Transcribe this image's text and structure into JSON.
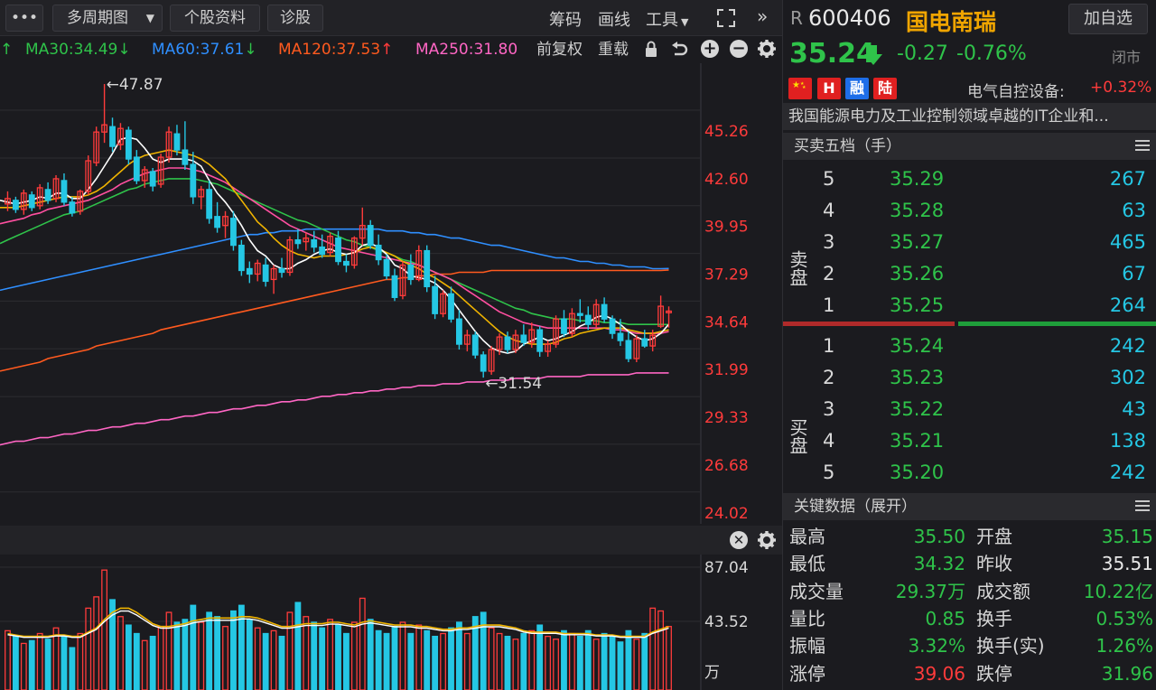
{
  "toolbar": {
    "more_label": "•••",
    "period_label": "多周期图",
    "stock_info_label": "个股资料",
    "diagnose_label": "诊股",
    "chips_label": "筹码",
    "draw_label": "画线",
    "tools_label": "工具",
    "expand_label": "»"
  },
  "ma_row": {
    "ma30": "MA30:34.49",
    "ma60": "MA60:37.61",
    "ma120": "MA120:37.53",
    "ma250": "MA250:31.80",
    "fq_label": "前复权",
    "overlay_label": "重载"
  },
  "colors": {
    "up": "#ff3b3b",
    "down": "#25c7e4",
    "green": "#2fc34a",
    "ma5": "#ffffff",
    "ma10": "#f0b400",
    "ma20": "#ff4fa0",
    "ma30": "#2fc34a",
    "ma60": "#2f8fff",
    "ma120": "#ff5a1f",
    "ma250": "#ff66c4"
  },
  "chart_data": {
    "type": "candlestick",
    "price_axis": [
      "45.26",
      "42.60",
      "39.95",
      "37.29",
      "34.64",
      "31.99",
      "29.33",
      "26.68",
      "24.02"
    ],
    "ylim": [
      24.02,
      47.9
    ],
    "high_annotation": "47.87",
    "low_annotation": "31.54",
    "volume_axis": [
      "87.04",
      "43.52",
      "万"
    ],
    "candles": [
      [
        41.2,
        41.9,
        40.8,
        41.5
      ],
      [
        41.4,
        41.6,
        40.7,
        40.9
      ],
      [
        40.9,
        42.0,
        40.6,
        41.8
      ],
      [
        41.7,
        41.9,
        40.8,
        41.0
      ],
      [
        41.1,
        42.3,
        40.9,
        42.1
      ],
      [
        42.0,
        42.4,
        41.2,
        41.4
      ],
      [
        41.5,
        42.8,
        41.3,
        42.6
      ],
      [
        42.5,
        42.9,
        41.1,
        41.3
      ],
      [
        41.3,
        41.6,
        40.5,
        40.7
      ],
      [
        40.8,
        42.0,
        40.6,
        41.9
      ],
      [
        41.9,
        43.9,
        41.7,
        43.6
      ],
      [
        43.5,
        45.5,
        43.3,
        45.2
      ],
      [
        45.2,
        47.87,
        44.6,
        45.6
      ],
      [
        45.5,
        46.0,
        44.1,
        44.4
      ],
      [
        44.5,
        45.7,
        44.2,
        45.4
      ],
      [
        45.3,
        45.5,
        43.4,
        43.7
      ],
      [
        43.8,
        44.2,
        42.3,
        42.5
      ],
      [
        42.5,
        43.3,
        42.1,
        43.1
      ],
      [
        43.0,
        43.2,
        41.9,
        42.2
      ],
      [
        42.3,
        44.0,
        42.1,
        43.8
      ],
      [
        43.8,
        45.5,
        43.5,
        45.2
      ],
      [
        45.1,
        45.6,
        43.9,
        44.2
      ],
      [
        44.2,
        45.8,
        43.1,
        43.4
      ],
      [
        43.4,
        44.1,
        41.2,
        41.6
      ],
      [
        41.6,
        42.2,
        40.9,
        42.0
      ],
      [
        42.0,
        42.5,
        40.1,
        40.4
      ],
      [
        40.5,
        41.3,
        39.6,
        39.9
      ],
      [
        40.0,
        40.8,
        39.3,
        40.5
      ],
      [
        40.4,
        40.8,
        38.6,
        38.9
      ],
      [
        38.9,
        39.2,
        37.2,
        37.5
      ],
      [
        37.6,
        38.0,
        36.8,
        37.3
      ],
      [
        37.3,
        38.1,
        36.9,
        37.9
      ],
      [
        37.8,
        38.2,
        36.6,
        36.9
      ],
      [
        37.0,
        37.8,
        36.2,
        37.6
      ],
      [
        37.6,
        38.2,
        37.1,
        37.4
      ],
      [
        37.4,
        39.4,
        37.2,
        39.2
      ],
      [
        39.2,
        39.8,
        38.7,
        39.0
      ],
      [
        39.1,
        39.6,
        38.6,
        39.3
      ],
      [
        39.2,
        39.7,
        38.5,
        38.8
      ],
      [
        38.8,
        39.5,
        38.2,
        38.4
      ],
      [
        38.5,
        39.6,
        38.3,
        39.4
      ],
      [
        39.3,
        39.7,
        37.8,
        38.0
      ],
      [
        38.0,
        38.4,
        37.4,
        37.8
      ],
      [
        37.8,
        39.4,
        37.6,
        39.3
      ],
      [
        39.3,
        41.0,
        38.9,
        40.0
      ],
      [
        40.0,
        40.3,
        38.7,
        38.9
      ],
      [
        38.9,
        39.5,
        37.8,
        38.1
      ],
      [
        38.1,
        38.4,
        37.0,
        37.2
      ],
      [
        37.2,
        37.6,
        35.8,
        36.0
      ],
      [
        36.1,
        38.0,
        35.9,
        37.8
      ],
      [
        37.8,
        38.4,
        36.7,
        37.0
      ],
      [
        37.0,
        38.9,
        36.9,
        38.6
      ],
      [
        38.6,
        38.9,
        36.3,
        36.6
      ],
      [
        36.6,
        37.2,
        34.8,
        35.1
      ],
      [
        35.1,
        36.4,
        34.9,
        36.2
      ],
      [
        36.2,
        36.6,
        34.6,
        34.8
      ],
      [
        34.8,
        35.3,
        33.1,
        33.4
      ],
      [
        33.4,
        34.2,
        33.0,
        33.9
      ],
      [
        33.9,
        34.1,
        32.6,
        32.8
      ],
      [
        32.8,
        33.0,
        31.54,
        31.9
      ],
      [
        31.9,
        33.3,
        31.7,
        33.1
      ],
      [
        33.1,
        34.0,
        32.8,
        33.8
      ],
      [
        33.8,
        34.1,
        32.9,
        33.1
      ],
      [
        33.1,
        34.2,
        32.9,
        33.9
      ],
      [
        33.9,
        34.5,
        33.3,
        33.5
      ],
      [
        33.5,
        34.6,
        33.2,
        34.2
      ],
      [
        34.2,
        34.4,
        32.7,
        33.0
      ],
      [
        33.0,
        33.6,
        32.7,
        33.4
      ],
      [
        33.4,
        35.0,
        33.2,
        34.8
      ],
      [
        34.8,
        35.3,
        33.8,
        34.0
      ],
      [
        34.0,
        35.4,
        33.8,
        35.1
      ],
      [
        35.1,
        35.9,
        34.6,
        35.0
      ],
      [
        35.0,
        35.5,
        34.2,
        34.5
      ],
      [
        34.5,
        35.9,
        34.3,
        35.6
      ],
      [
        35.6,
        36.0,
        34.6,
        34.8
      ],
      [
        34.8,
        35.0,
        33.7,
        34.0
      ],
      [
        34.0,
        34.8,
        33.3,
        33.6
      ],
      [
        33.6,
        34.1,
        32.4,
        32.6
      ],
      [
        32.6,
        33.9,
        32.4,
        33.7
      ],
      [
        33.7,
        34.2,
        33.2,
        33.3
      ],
      [
        33.3,
        34.2,
        33.0,
        33.9
      ],
      [
        34.4,
        36.1,
        34.3,
        35.51
      ],
      [
        35.15,
        35.5,
        34.32,
        35.24
      ]
    ],
    "ma": {
      "ma5": [
        41.3,
        41.2,
        41.3,
        41.4,
        41.6,
        41.5,
        41.8,
        41.8,
        41.5,
        41.5,
        42.0,
        42.6,
        43.3,
        44.0,
        44.8,
        44.9,
        44.8,
        44.3,
        43.7,
        43.5,
        43.7,
        43.7,
        43.7,
        43.6,
        43.3,
        42.5,
        41.8,
        41.3,
        40.7,
        40.0,
        39.2,
        38.6,
        38.3,
        37.8,
        37.6,
        37.6,
        37.9,
        38.1,
        38.4,
        38.6,
        38.7,
        38.5,
        38.4,
        38.5,
        38.9,
        39.0,
        38.8,
        38.4,
        37.8,
        37.6,
        37.2,
        37.1,
        37.0,
        36.8,
        36.4,
        35.9,
        35.3,
        34.7,
        34.1,
        33.6,
        33.2,
        33.0,
        32.9,
        33.0,
        33.4,
        33.6,
        33.8,
        33.6,
        33.7,
        33.9,
        34.1,
        34.4,
        34.6,
        34.9,
        35.0,
        34.8,
        34.5,
        34.1,
        33.8,
        33.6,
        33.7,
        34.0,
        34.5
      ],
      "ma10": [
        41.0,
        41.0,
        41.1,
        41.2,
        41.3,
        41.4,
        41.5,
        41.6,
        41.6,
        41.6,
        41.7,
        41.9,
        42.2,
        42.6,
        43.0,
        43.4,
        43.7,
        43.9,
        44.0,
        44.1,
        44.2,
        44.1,
        44.0,
        43.9,
        43.7,
        43.4,
        43.0,
        42.6,
        42.0,
        41.4,
        40.8,
        40.2,
        39.8,
        39.3,
        38.9,
        38.6,
        38.4,
        38.3,
        38.2,
        38.3,
        38.3,
        38.3,
        38.4,
        38.5,
        38.7,
        38.8,
        38.7,
        38.5,
        38.3,
        38.0,
        37.8,
        37.6,
        37.3,
        37.1,
        36.8,
        36.5,
        36.1,
        35.7,
        35.3,
        34.9,
        34.5,
        34.1,
        33.8,
        33.6,
        33.5,
        33.4,
        33.4,
        33.4,
        33.5,
        33.7,
        33.8,
        34.0,
        34.1,
        34.2,
        34.3,
        34.3,
        34.3,
        34.2,
        34.1,
        34.0,
        34.0,
        34.1,
        34.2
      ],
      "ma20": [
        40.2,
        40.3,
        40.4,
        40.6,
        40.7,
        40.9,
        41.0,
        41.1,
        41.2,
        41.3,
        41.4,
        41.6,
        41.8,
        42.0,
        42.3,
        42.5,
        42.7,
        42.9,
        43.0,
        43.1,
        43.2,
        43.2,
        43.2,
        43.1,
        43.0,
        42.8,
        42.6,
        42.4,
        42.1,
        41.8,
        41.5,
        41.2,
        40.9,
        40.6,
        40.3,
        40.0,
        39.8,
        39.6,
        39.4,
        39.2,
        39.0,
        38.8,
        38.7,
        38.6,
        38.5,
        38.4,
        38.3,
        38.2,
        38.1,
        38.0,
        37.9,
        37.8,
        37.6,
        37.4,
        37.2,
        37.0,
        36.7,
        36.4,
        36.1,
        35.8,
        35.5,
        35.2,
        35.0,
        34.8,
        34.6,
        34.5,
        34.4,
        34.3,
        34.3,
        34.3,
        34.3,
        34.3,
        34.3,
        34.3,
        34.3,
        34.2,
        34.2,
        34.1,
        34.0,
        34.0,
        34.0,
        34.0,
        34.1
      ],
      "ma30": [
        39.2,
        39.4,
        39.6,
        39.8,
        40.0,
        40.2,
        40.4,
        40.6,
        40.7,
        40.8,
        41.0,
        41.2,
        41.4,
        41.6,
        41.8,
        42.0,
        42.1,
        42.3,
        42.4,
        42.5,
        42.6,
        42.6,
        42.6,
        42.6,
        42.5,
        42.4,
        42.3,
        42.1,
        41.9,
        41.7,
        41.5,
        41.3,
        41.1,
        40.9,
        40.7,
        40.5,
        40.3,
        40.2,
        40.0,
        39.8,
        39.6,
        39.4,
        39.2,
        39.1,
        38.9,
        38.8,
        38.6,
        38.5,
        38.3,
        38.1,
        38.0,
        37.8,
        37.6,
        37.4,
        37.2,
        37.0,
        36.8,
        36.6,
        36.4,
        36.2,
        36.0,
        35.8,
        35.6,
        35.4,
        35.3,
        35.1,
        35.0,
        34.9,
        34.8,
        34.8,
        34.8,
        34.7,
        34.7,
        34.7,
        34.6,
        34.6,
        34.6,
        34.5,
        34.5,
        34.5,
        34.5,
        34.5,
        34.49
      ],
      "ma60": [
        36.5,
        36.6,
        36.7,
        36.8,
        36.9,
        37.0,
        37.1,
        37.2,
        37.3,
        37.4,
        37.5,
        37.6,
        37.7,
        37.8,
        37.9,
        38.0,
        38.1,
        38.2,
        38.3,
        38.4,
        38.5,
        38.6,
        38.7,
        38.8,
        38.9,
        39.0,
        39.1,
        39.2,
        39.3,
        39.4,
        39.5,
        39.5,
        39.6,
        39.6,
        39.7,
        39.7,
        39.7,
        39.8,
        39.8,
        39.8,
        39.8,
        39.8,
        39.8,
        39.8,
        39.8,
        39.8,
        39.8,
        39.7,
        39.7,
        39.7,
        39.6,
        39.6,
        39.5,
        39.5,
        39.4,
        39.3,
        39.3,
        39.2,
        39.1,
        39.0,
        38.9,
        38.9,
        38.8,
        38.7,
        38.6,
        38.5,
        38.4,
        38.3,
        38.2,
        38.2,
        38.1,
        38.0,
        38.0,
        37.9,
        37.9,
        37.8,
        37.8,
        37.7,
        37.7,
        37.7,
        37.6,
        37.6,
        37.61
      ],
      "ma120": [
        32.0,
        32.1,
        32.2,
        32.3,
        32.4,
        32.6,
        32.7,
        32.8,
        32.9,
        33.0,
        33.1,
        33.3,
        33.4,
        33.5,
        33.6,
        33.7,
        33.8,
        33.9,
        34.0,
        34.2,
        34.3,
        34.4,
        34.5,
        34.6,
        34.7,
        34.8,
        34.9,
        35.0,
        35.1,
        35.2,
        35.3,
        35.4,
        35.5,
        35.6,
        35.7,
        35.8,
        35.9,
        36.0,
        36.1,
        36.2,
        36.3,
        36.4,
        36.5,
        36.6,
        36.7,
        36.8,
        36.9,
        37.0,
        37.0,
        37.1,
        37.1,
        37.2,
        37.2,
        37.3,
        37.3,
        37.3,
        37.4,
        37.4,
        37.4,
        37.4,
        37.5,
        37.5,
        37.5,
        37.5,
        37.5,
        37.5,
        37.5,
        37.5,
        37.5,
        37.5,
        37.5,
        37.5,
        37.5,
        37.5,
        37.5,
        37.5,
        37.5,
        37.5,
        37.5,
        37.5,
        37.5,
        37.5,
        37.53
      ],
      "ma250": [
        27.9,
        28.0,
        28.0,
        28.1,
        28.2,
        28.2,
        28.3,
        28.4,
        28.4,
        28.5,
        28.6,
        28.6,
        28.7,
        28.8,
        28.8,
        28.9,
        29.0,
        29.0,
        29.1,
        29.2,
        29.2,
        29.3,
        29.4,
        29.4,
        29.5,
        29.6,
        29.6,
        29.7,
        29.8,
        29.8,
        29.9,
        30.0,
        30.0,
        30.1,
        30.2,
        30.2,
        30.3,
        30.3,
        30.4,
        30.5,
        30.5,
        30.6,
        30.6,
        30.7,
        30.7,
        30.8,
        30.8,
        30.9,
        30.9,
        31.0,
        31.0,
        31.1,
        31.1,
        31.1,
        31.2,
        31.2,
        31.2,
        31.3,
        31.3,
        31.3,
        31.4,
        31.4,
        31.4,
        31.5,
        31.5,
        31.5,
        31.5,
        31.6,
        31.6,
        31.6,
        31.6,
        31.6,
        31.7,
        31.7,
        31.7,
        31.7,
        31.7,
        31.7,
        31.8,
        31.8,
        31.8,
        31.8,
        31.8
      ]
    },
    "volume": [
      42,
      38,
      33,
      35,
      40,
      36,
      44,
      38,
      30,
      40,
      58,
      66,
      85,
      64,
      52,
      46,
      40,
      35,
      38,
      45,
      55,
      48,
      50,
      60,
      48,
      55,
      52,
      45,
      56,
      60,
      50,
      44,
      40,
      42,
      38,
      55,
      62,
      52,
      48,
      44,
      50,
      46,
      40,
      48,
      65,
      50,
      42,
      40,
      45,
      48,
      40,
      46,
      42,
      38,
      40,
      44,
      48,
      40,
      52,
      55,
      44,
      40,
      38,
      36,
      40,
      42,
      46,
      38,
      36,
      42,
      40,
      38,
      42,
      36,
      40,
      38,
      34,
      42,
      36,
      40,
      58,
      56,
      45
    ],
    "volume_ma": [
      40,
      39,
      38,
      38,
      38,
      38,
      39,
      39,
      38,
      38,
      41,
      44,
      50,
      55,
      58,
      58,
      55,
      51,
      47,
      45,
      45,
      46,
      47,
      49,
      50,
      51,
      51,
      51,
      51,
      52,
      52,
      51,
      49,
      47,
      45,
      45,
      46,
      47,
      47,
      47,
      48,
      48,
      47,
      46,
      48,
      49,
      48,
      47,
      46,
      46,
      46,
      45,
      45,
      44,
      43,
      43,
      44,
      44,
      45,
      46,
      46,
      46,
      45,
      44,
      42,
      41,
      41,
      41,
      41,
      40,
      40,
      40,
      40,
      39,
      39,
      39,
      38,
      38,
      38,
      38,
      41,
      43,
      45
    ]
  },
  "right_panel": {
    "r_mark": "R",
    "code": "600406",
    "name": "国电南瑞",
    "add_watch": "加自选",
    "price": "35.24",
    "change": "-0.27",
    "change_pct": "-0.76%",
    "status": "闭市",
    "tags": [
      "",
      "H",
      "融",
      "陆"
    ],
    "sector": "电气自控设备:",
    "sector_pct": "+0.32%",
    "description": "我国能源电力及工业控制领域卓越的IT企业和...",
    "orderbook_title": "买卖五档（手）",
    "sell_label": "卖盘",
    "buy_label": "买盘",
    "asks": [
      {
        "level": "5",
        "price": "35.29",
        "qty": "267"
      },
      {
        "level": "4",
        "price": "35.28",
        "qty": "63"
      },
      {
        "level": "3",
        "price": "35.27",
        "qty": "465"
      },
      {
        "level": "2",
        "price": "35.26",
        "qty": "67"
      },
      {
        "level": "1",
        "price": "35.25",
        "qty": "264"
      }
    ],
    "bids": [
      {
        "level": "1",
        "price": "35.24",
        "qty": "242"
      },
      {
        "level": "2",
        "price": "35.23",
        "qty": "302"
      },
      {
        "level": "3",
        "price": "35.22",
        "qty": "43"
      },
      {
        "level": "4",
        "price": "35.21",
        "qty": "138"
      },
      {
        "level": "5",
        "price": "35.20",
        "qty": "242"
      }
    ],
    "key_title": "关键数据（展开）",
    "key_data": [
      {
        "k1": "最高",
        "v1": "35.50",
        "c1": "green",
        "k2": "开盘",
        "v2": "35.15",
        "c2": "green"
      },
      {
        "k1": "最低",
        "v1": "34.32",
        "c1": "green",
        "k2": "昨收",
        "v2": "35.51",
        "c2": "white"
      },
      {
        "k1": "成交量",
        "v1": "29.37万",
        "c1": "green",
        "k2": "成交额",
        "v2": "10.22亿",
        "c2": "green"
      },
      {
        "k1": "量比",
        "v1": "0.85",
        "c1": "green",
        "k2": "换手",
        "v2": "0.53%",
        "c2": "green"
      },
      {
        "k1": "振幅",
        "v1": "3.32%",
        "c1": "green",
        "k2": "换手(实)",
        "v2": "1.26%",
        "c2": "green"
      },
      {
        "k1": "涨停",
        "v1": "39.06",
        "c1": "red",
        "k2": "跌停",
        "v2": "31.96",
        "c2": "green"
      }
    ]
  }
}
